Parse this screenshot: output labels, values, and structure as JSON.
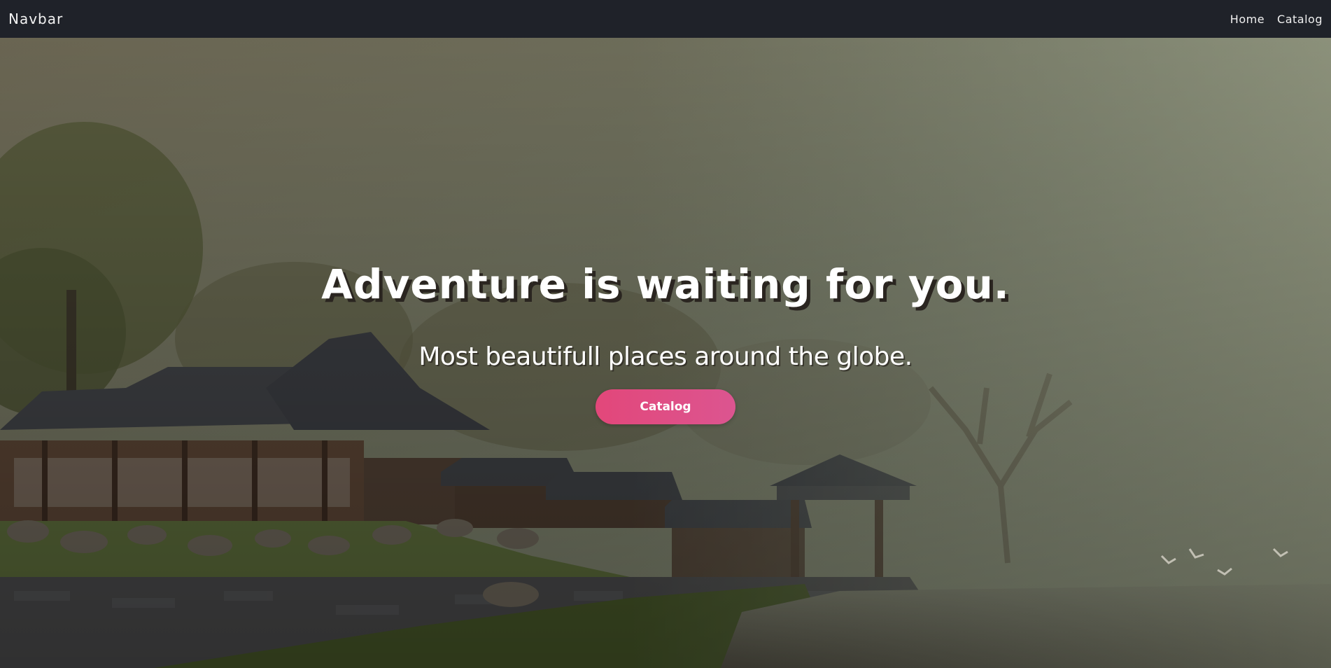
{
  "navbar": {
    "brand": "Navbar",
    "links": [
      {
        "label": "Home"
      },
      {
        "label": "Catalog"
      }
    ]
  },
  "hero": {
    "title": "Adventure is waiting for you.",
    "subtitle": "Most beautifull places around the globe.",
    "button_label": "Catalog",
    "button_color": "#e2477a",
    "background_image": "chinese-pavilion-landscape"
  }
}
